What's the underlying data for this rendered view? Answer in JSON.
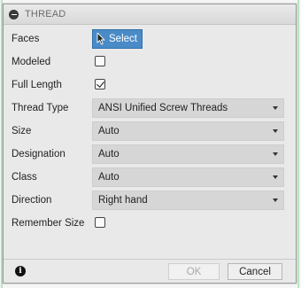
{
  "dialog": {
    "title": "THREAD",
    "rows": [
      {
        "label": "Faces",
        "control": "select",
        "button_label": "Select"
      },
      {
        "label": "Modeled",
        "control": "checkbox",
        "checked": false
      },
      {
        "label": "Full Length",
        "control": "checkbox",
        "checked": true
      },
      {
        "label": "Thread Type",
        "control": "dropdown",
        "value": "ANSI Unified Screw Threads"
      },
      {
        "label": "Size",
        "control": "dropdown",
        "value": "Auto"
      },
      {
        "label": "Designation",
        "control": "dropdown",
        "value": "Auto"
      },
      {
        "label": "Class",
        "control": "dropdown",
        "value": "Auto"
      },
      {
        "label": "Direction",
        "control": "dropdown",
        "value": "Right hand"
      },
      {
        "label": "Remember Size",
        "control": "checkbox",
        "checked": false
      }
    ],
    "footer": {
      "ok_label": "OK",
      "cancel_label": "Cancel",
      "ok_enabled": false
    }
  },
  "colors": {
    "select_button": "#4a8bc7",
    "dropdown_bg": "#d6d6d6",
    "background_grid": "#b9e6c1"
  },
  "icons": {
    "collapse": "collapse-icon",
    "cursor": "cursor-icon",
    "info": "info-icon",
    "dropdown_caret": "chevron-down-icon"
  }
}
